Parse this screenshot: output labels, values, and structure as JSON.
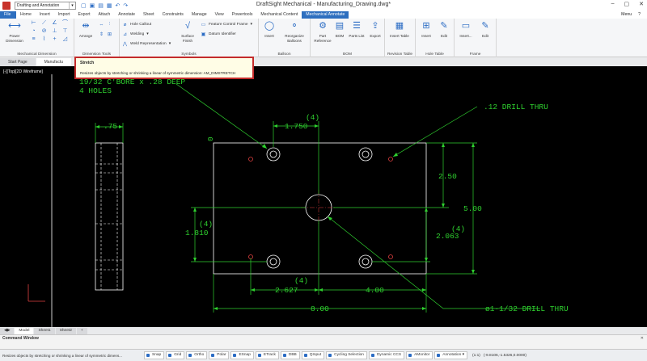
{
  "window": {
    "title": "DraftSight Mechanical - Manufacturing_Drawing.dwg*",
    "workspace": "Drafting and Annotation"
  },
  "menu": {
    "tabs": [
      "File",
      "Home",
      "Insert",
      "Import",
      "Export",
      "Attach",
      "Annotate",
      "Sheet",
      "Constraints",
      "Manage",
      "View",
      "Powertools",
      "Mechanical Content",
      "Mechanical Annotate"
    ],
    "active_tab": "Mechanical Annotate",
    "right_label": "Menu"
  },
  "ribbon": {
    "power_dimension": "Power Dimension",
    "mechanical_dimension_group": "Mechanical Dimension",
    "arrange": "Arrange",
    "dimension_tools_group": "Dimension Tools",
    "hole_callout": "Hole Callout",
    "welding": "Welding",
    "weld_representation": "Weld Representation",
    "surface_finish": "Surface Finish",
    "feature_control_frame": "Feature Control Frame",
    "datum_identifier": "Datum Identifier",
    "symbols_group": "Symbols",
    "insert": "Insert",
    "reorganize_balloons": "Reorganize Balloons",
    "balloon_group": "Balloon",
    "part_reference": "Part Reference",
    "bom": "BOM",
    "parts_list": "Parts List",
    "export": "Export",
    "bom_group": "BOM",
    "insert_table": "Insert Table",
    "revision_table_group": "Revision Table",
    "edit": "Edit",
    "hole_table_group": "Hole Table",
    "frame_insert": "Insert...",
    "frame_edit": "Edit",
    "frame_group": "Frame"
  },
  "doc_tabs": [
    "Start Page",
    "Manufactu"
  ],
  "tooltip": {
    "title": "Stretch",
    "description": "Resizes objects by stretching or shrinking a linear of symmetric dimension:  AM_DIMSTRETCH"
  },
  "viewport": {
    "label": "[-][Top][2D Wireframe]"
  },
  "drawing": {
    "note_cbore": "19/32 C'BORE x .28 DEEP",
    "note_holes": "4 HOLES",
    "drill_small": ".12 DRILL THRU",
    "drill_large": "ø1-1/32 DRILL THRU",
    "dim_75": ".75",
    "dim_1750": "1.750",
    "dim_4_top": "(4)",
    "dim_250": "2.50",
    "dim_500": "5.00",
    "dim_2063": "2.063",
    "dim_4_right": "(4)",
    "dim_1810": "1.810",
    "dim_4_left": "(4)",
    "dim_2627": "2.627",
    "dim_4_bottom": "(4)",
    "dim_400": "4.00",
    "dim_800": "8.00",
    "origin_0": "0"
  },
  "sheet_tabs": [
    "Model",
    "Sheet1",
    "Sheet2",
    "+"
  ],
  "command_window": {
    "title": "Command Window"
  },
  "status": {
    "message": "Resizes objects by stretching or shrinking a linear of symmetric dimens...",
    "toggles": [
      "Snap",
      "Grid",
      "Ortho",
      "Polar",
      "ESnap",
      "ETrack",
      "DBB",
      "QInput",
      "Cycling Selection",
      "Dynamic CCS",
      "AMonitor"
    ],
    "annotation": "Annotation",
    "scale": "(1:1)",
    "coords": "(-9.8106,-1.5326,0.0000)"
  }
}
